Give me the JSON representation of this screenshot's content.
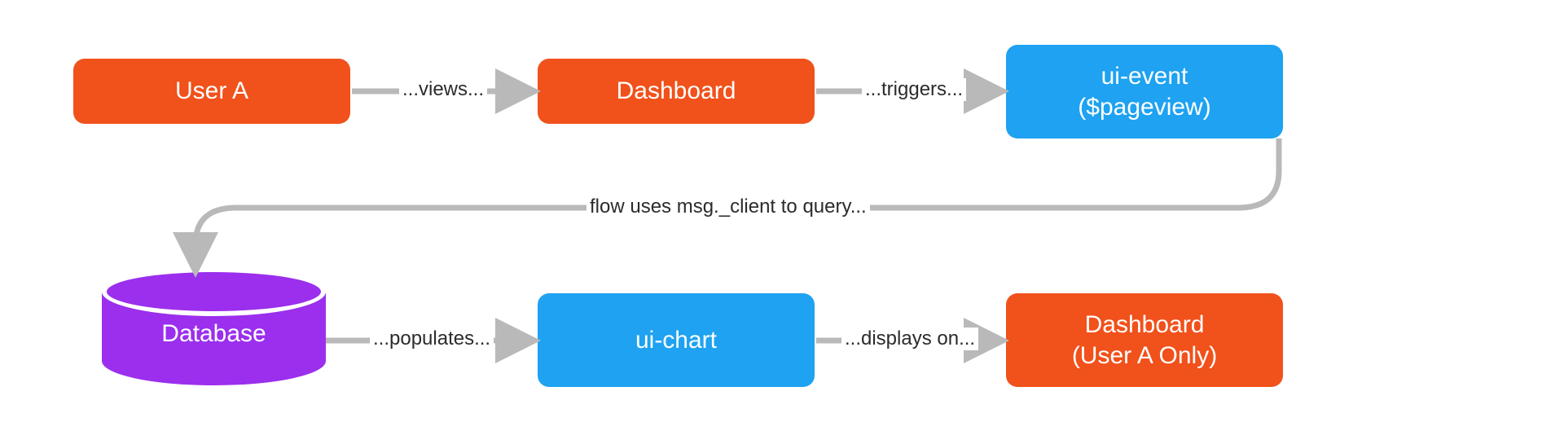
{
  "nodes": {
    "user_a": {
      "label": "User A"
    },
    "dashboard": {
      "label": "Dashboard"
    },
    "ui_event": {
      "line1": "ui-event",
      "line2": "($pageview)"
    },
    "database": {
      "label": "Database"
    },
    "ui_chart": {
      "label": "ui-chart"
    },
    "dashboard_user_a": {
      "line1": "Dashboard",
      "line2": "(User A Only)"
    }
  },
  "edges": {
    "views": "...views...",
    "triggers": "...triggers...",
    "flow_query": "flow uses msg._client to query...",
    "populates": "...populates...",
    "displays_on": "...displays on..."
  },
  "colors": {
    "orange": "#f1511b",
    "blue": "#1ea2f1",
    "purple": "#9b2fed",
    "arrow": "#b9b9b9",
    "text": "#2b2b2b"
  }
}
